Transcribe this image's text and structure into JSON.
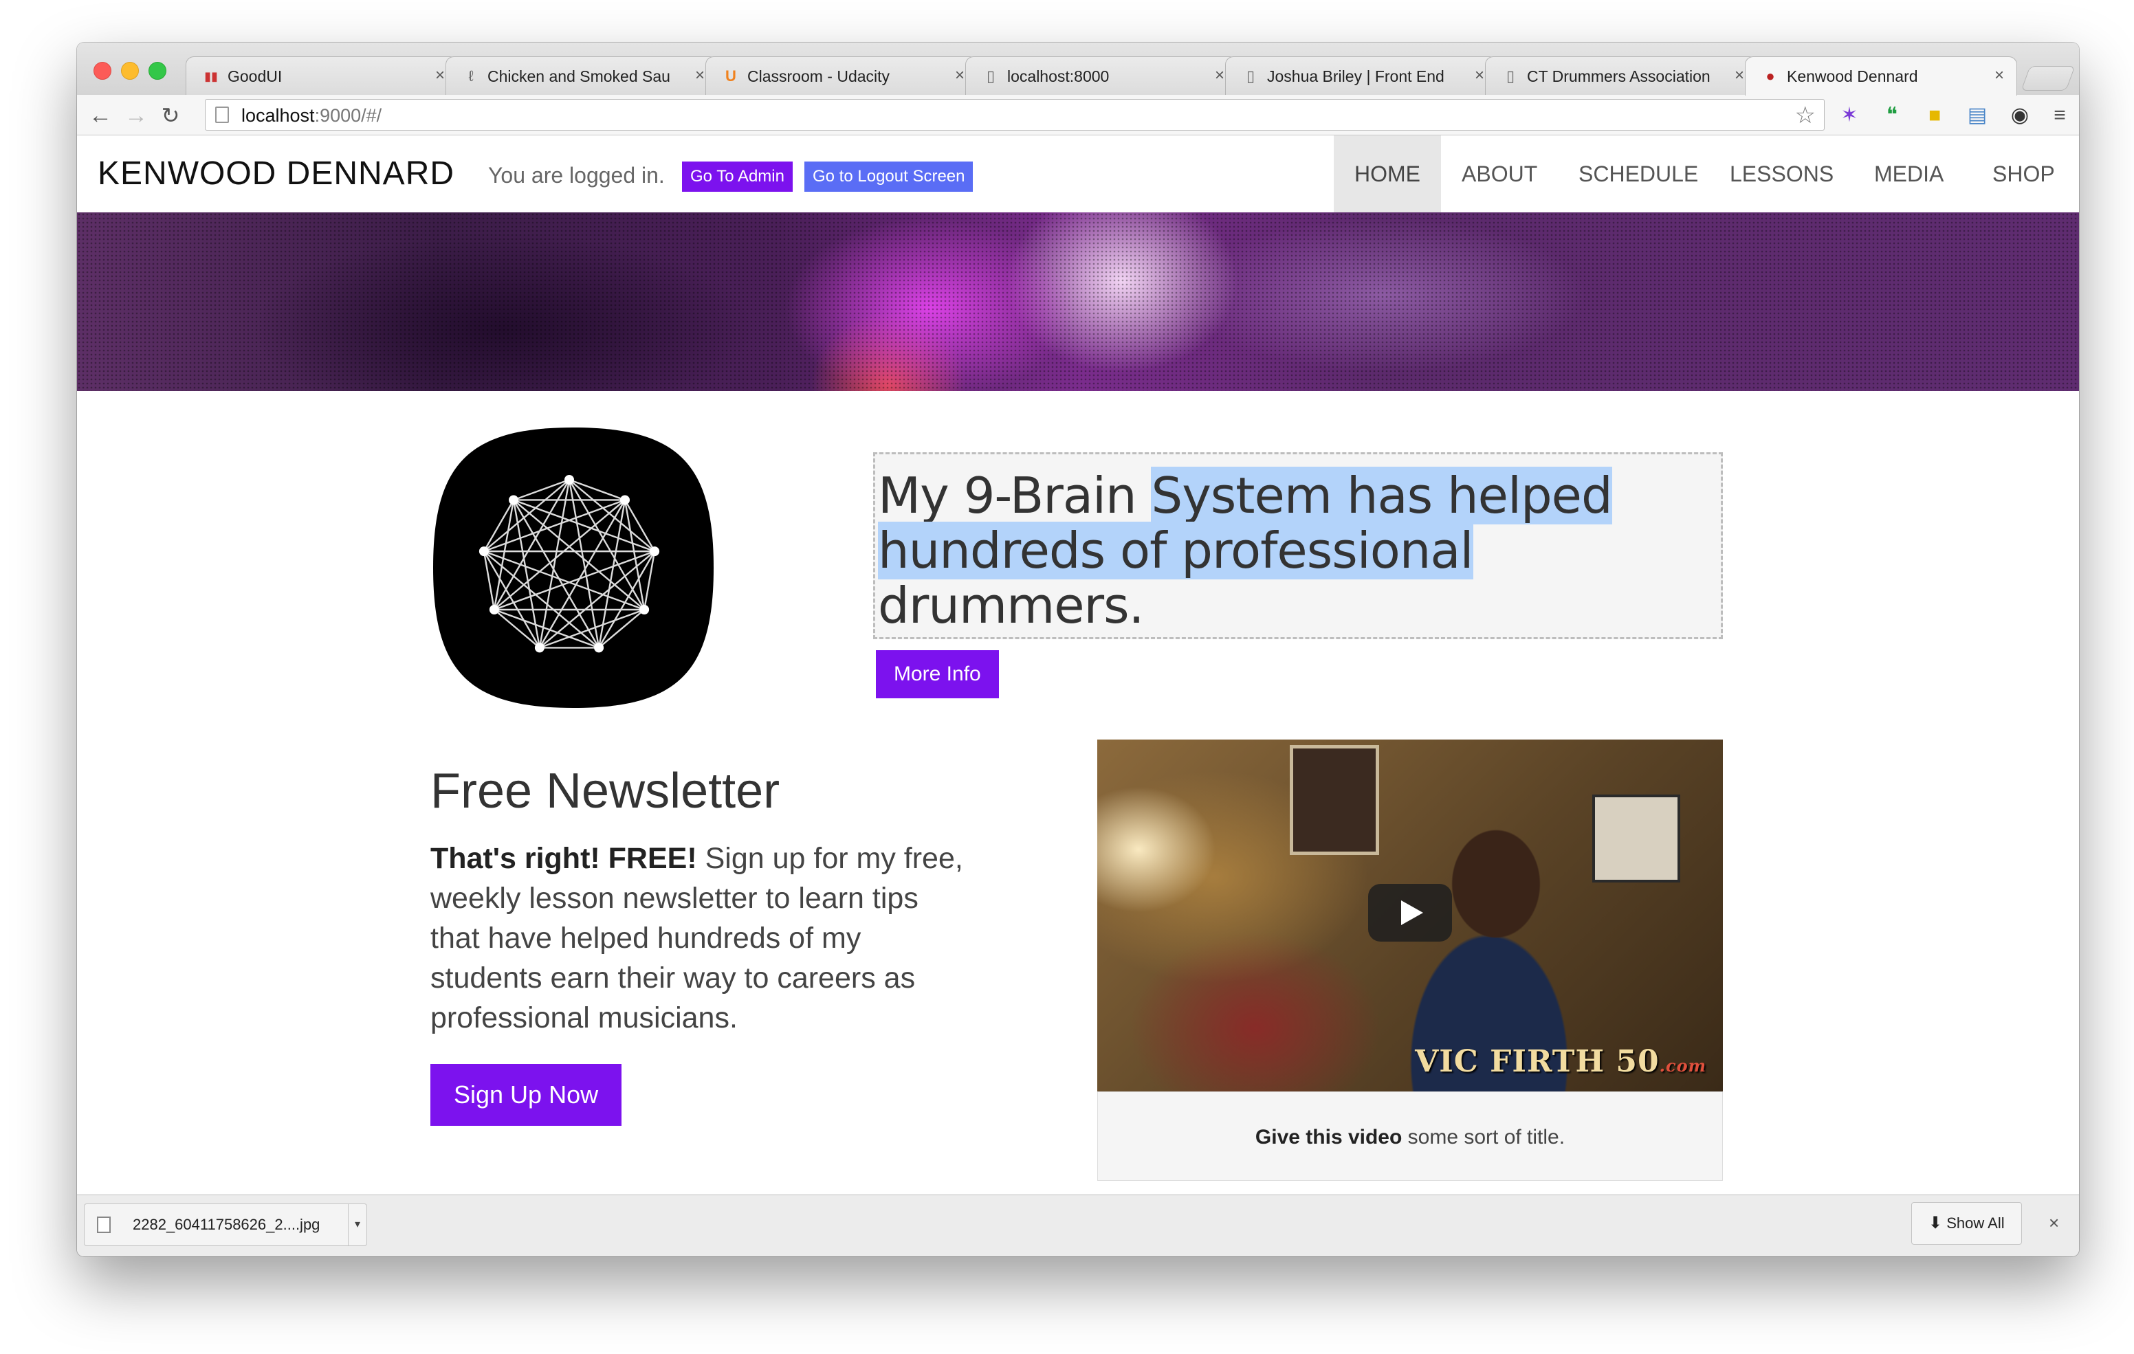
{
  "browser": {
    "tabs": [
      {
        "title": "GoodUI",
        "icon": "goodui-icon"
      },
      {
        "title": "Chicken and Smoked Sau",
        "icon": "page-icon"
      },
      {
        "title": "Classroom - Udacity",
        "icon": "udacity-icon"
      },
      {
        "title": "localhost:8000",
        "icon": "page-icon"
      },
      {
        "title": "Joshua Briley | Front End",
        "icon": "page-icon"
      },
      {
        "title": "CT Drummers Association",
        "icon": "page-icon"
      },
      {
        "title": "Kenwood Dennard",
        "icon": "kenwood-icon"
      }
    ],
    "active_tab": 6,
    "url_host": "localhost",
    "url_rest": ":9000/#/"
  },
  "site": {
    "brand": "KENWOOD DENNARD",
    "logged_in_text": "You are logged in.",
    "admin_button": "Go To Admin",
    "logout_button": "Go to Logout Screen",
    "nav": [
      "HOME",
      "ABOUT",
      "SCHEDULE",
      "LESSONS",
      "MEDIA",
      "SHOP"
    ],
    "nav_active": "HOME",
    "accent_color": "#7c12ee"
  },
  "hero_section": {
    "headline_plain": "My 9-Brain ",
    "headline_selected_1": "System has helped",
    "headline_selected_2": "hundreds of professional",
    "headline_end": "drummers.",
    "more_info_button": "More Info"
  },
  "newsletter": {
    "title": "Free Newsletter",
    "lead_bold": "That's right! FREE!",
    "body": " Sign up for my free, weekly lesson newsletter to learn tips that have helped hundreds of my students earn their way to careers as professional musicians.",
    "signup_button": "Sign Up Now"
  },
  "video": {
    "watermark": "VIC FIRTH 50",
    "watermark_suffix": ".com",
    "caption_bold": "Give this video",
    "caption_rest": " some sort of title."
  },
  "downloads": {
    "filename": "2282_60411758626_2....jpg",
    "show_all": "Show All"
  }
}
